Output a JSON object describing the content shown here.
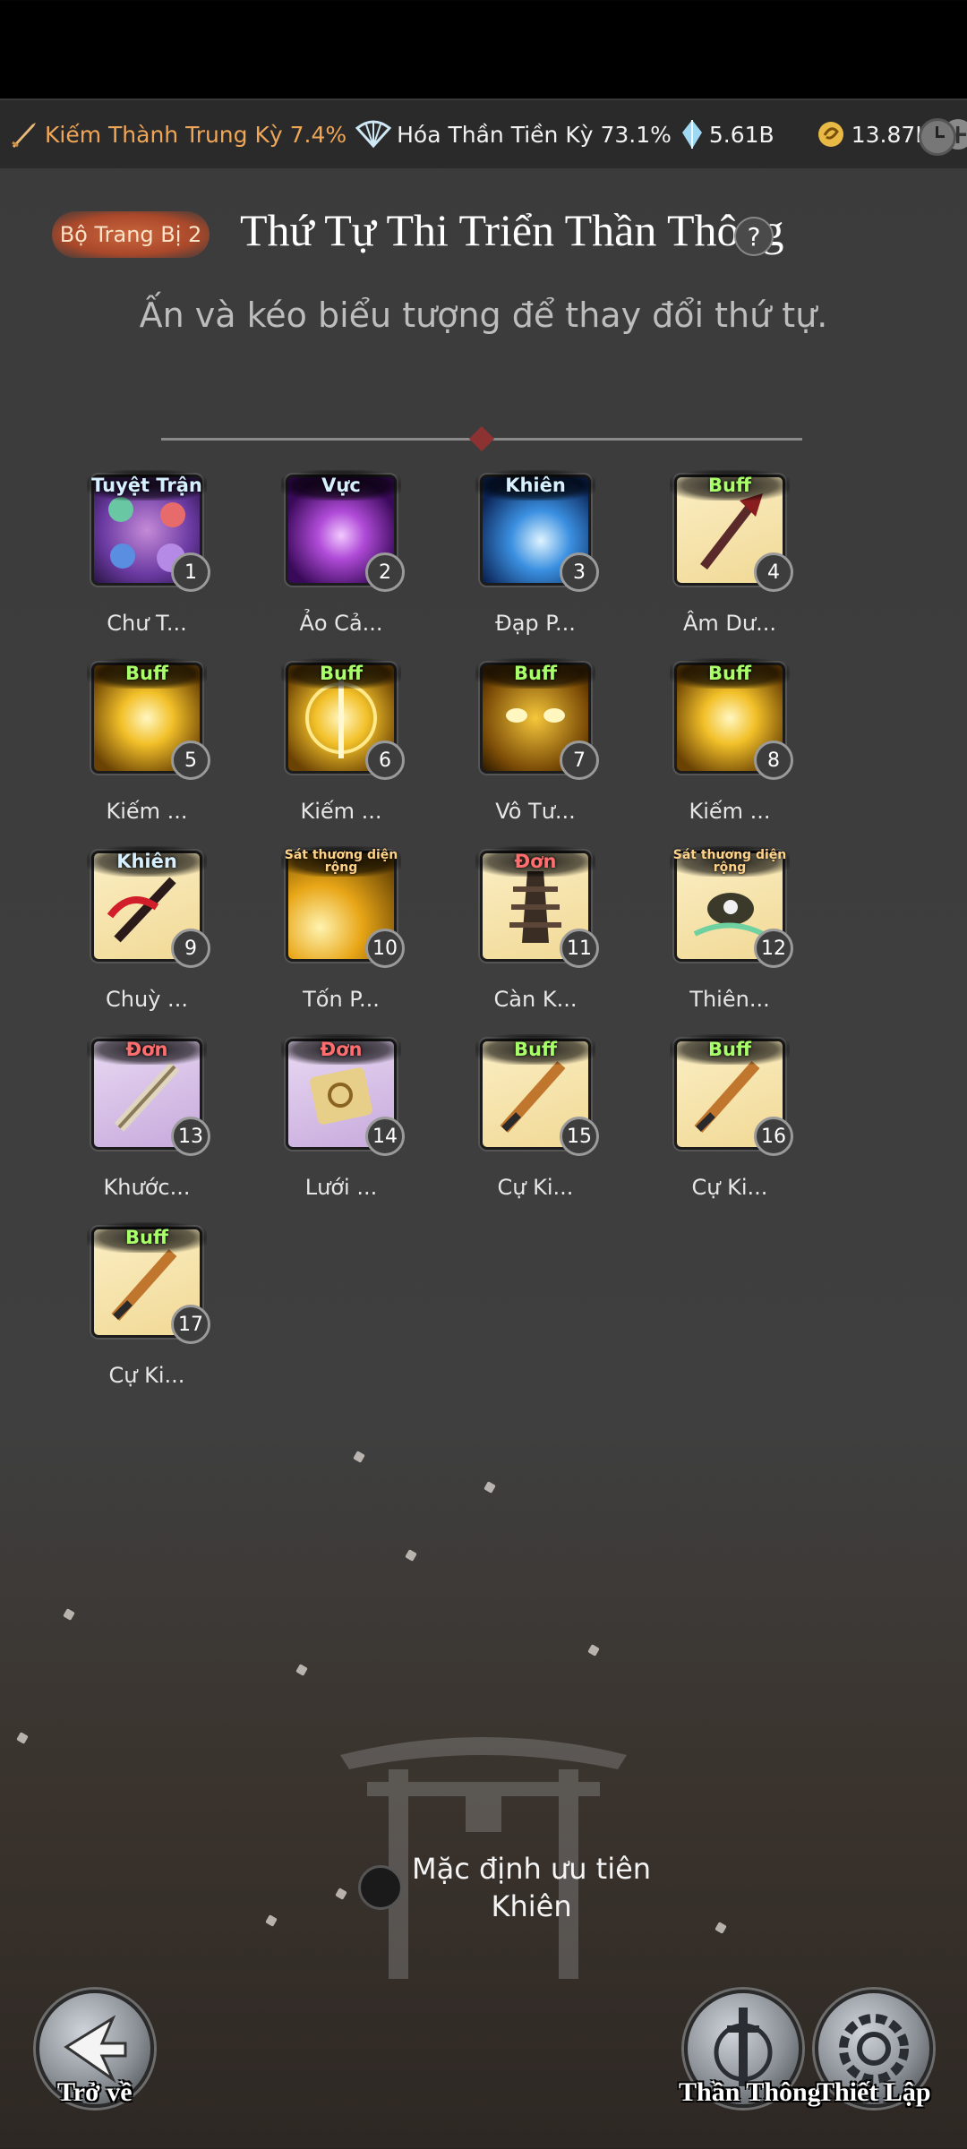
{
  "resources": {
    "realm1": "Kiếm Thành Trung Kỳ 7.4%",
    "realm2": "Hóa Thần Tiền Kỳ 73.1%",
    "crystal": "5.61B",
    "spirit_stone": "13.87K",
    "plus": "+"
  },
  "header": {
    "loadout_tag": "Bộ Trang Bị 2",
    "title": "Thứ Tự Thi Triển Thần Thông",
    "help": "?",
    "subtitle": "Ấn và kéo biểu tượng để thay đổi thứ tự."
  },
  "skills": [
    {
      "num": "1",
      "category": "Tuyệt Trận",
      "name": "Chư T..."
    },
    {
      "num": "2",
      "category": "Vực",
      "name": "Ảo Cả..."
    },
    {
      "num": "3",
      "category": "Khiên",
      "name": "Đạp P..."
    },
    {
      "num": "4",
      "category": "Buff",
      "name": "Âm Dư..."
    },
    {
      "num": "5",
      "category": "Buff",
      "name": "Kiếm ..."
    },
    {
      "num": "6",
      "category": "Buff",
      "name": "Kiếm ..."
    },
    {
      "num": "7",
      "category": "Buff",
      "name": "Vô Tư..."
    },
    {
      "num": "8",
      "category": "Buff",
      "name": "Kiếm ..."
    },
    {
      "num": "9",
      "category": "Khiên",
      "name": "Chuỳ ..."
    },
    {
      "num": "10",
      "category": "Sát thương diện rộng",
      "name": "Tốn P..."
    },
    {
      "num": "11",
      "category": "Đơn",
      "name": "Càn K..."
    },
    {
      "num": "12",
      "category": "Sát thương diện rộng",
      "name": "Thiên..."
    },
    {
      "num": "13",
      "category": "Đơn",
      "name": "Khước..."
    },
    {
      "num": "14",
      "category": "Đơn",
      "name": "Lưới ..."
    },
    {
      "num": "15",
      "category": "Buff",
      "name": "Cự Ki..."
    },
    {
      "num": "16",
      "category": "Buff",
      "name": "Cự Ki..."
    },
    {
      "num": "17",
      "category": "Buff",
      "name": "Cự Ki..."
    }
  ],
  "default_option": {
    "line1": "Mặc định ưu tiên",
    "line2": "Khiên"
  },
  "buttons": {
    "back": "Trở về",
    "divine": "Thần Thông",
    "settings": "Thiết Lập"
  }
}
